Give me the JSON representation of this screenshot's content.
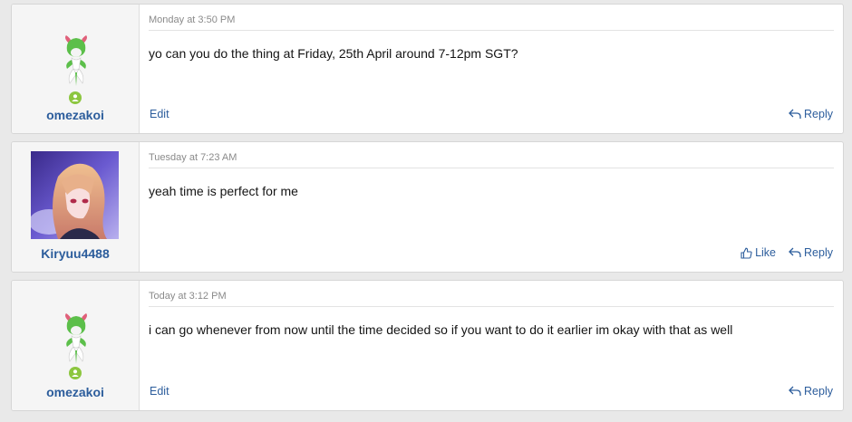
{
  "posts": [
    {
      "user": {
        "name": "omezakoi",
        "avatar_type": "sprite-icon",
        "online": true
      },
      "date": "Monday at 3:50 PM",
      "text": "yo can you do the thing at Friday, 25th April around 7-12pm SGT?",
      "actions": {
        "edit": "Edit",
        "reply": "Reply"
      }
    },
    {
      "user": {
        "name": "Kiryuu4488",
        "avatar_type": "anime-portrait-image",
        "online": false
      },
      "date": "Tuesday at 7:23 AM",
      "text": "yeah time is perfect for me",
      "actions": {
        "like": "Like",
        "reply": "Reply"
      }
    },
    {
      "user": {
        "name": "omezakoi",
        "avatar_type": "sprite-icon",
        "online": true
      },
      "date": "Today at 3:12 PM",
      "text": "i can go whenever from now until the time decided so if you want to do it earlier im okay with that as well",
      "actions": {
        "edit": "Edit",
        "reply": "Reply"
      }
    }
  ],
  "colors": {
    "link": "#2c5d9c",
    "online": "#8cc63f",
    "page_bg": "#e9e9e9"
  }
}
